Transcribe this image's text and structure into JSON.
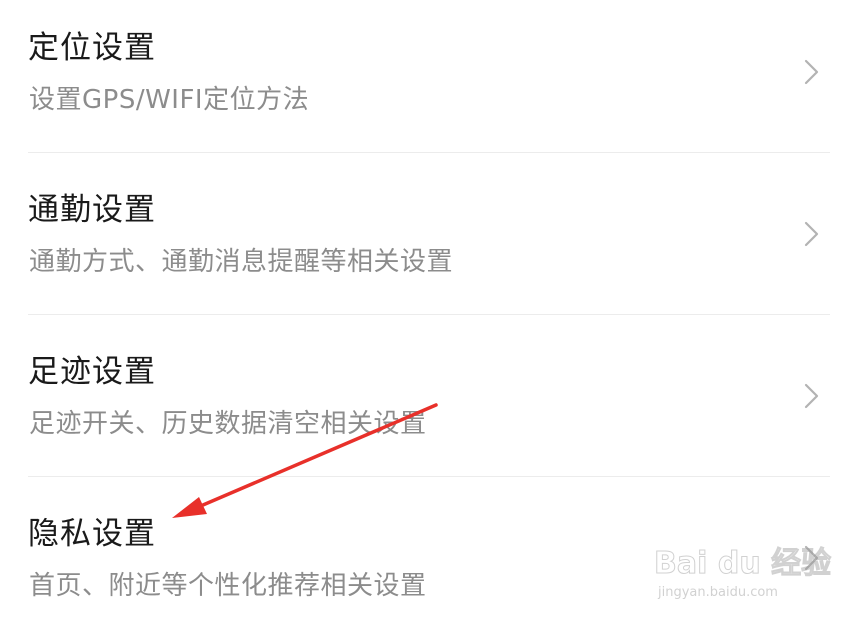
{
  "settings": {
    "items": [
      {
        "title": "定位设置",
        "subtitle": "设置GPS/WIFI定位方法"
      },
      {
        "title": "通勤设置",
        "subtitle": "通勤方式、通勤消息提醒等相关设置"
      },
      {
        "title": "足迹设置",
        "subtitle": "足迹开关、历史数据清空相关设置"
      },
      {
        "title": "隐私设置",
        "subtitle": "首页、附近等个性化推荐相关设置"
      }
    ]
  },
  "annotation": {
    "arrow_color": "#e8302a",
    "target": "隐私设置"
  },
  "watermark": {
    "logo_text": "Bai du 经验",
    "url_text": "jingyan.baidu.com"
  },
  "icons": {
    "chevron": "chevron-right-icon"
  },
  "colors": {
    "title": "#1a1a1a",
    "subtitle": "#8c8c8c",
    "divider": "#ececec",
    "chevron": "#b3b3b3"
  }
}
